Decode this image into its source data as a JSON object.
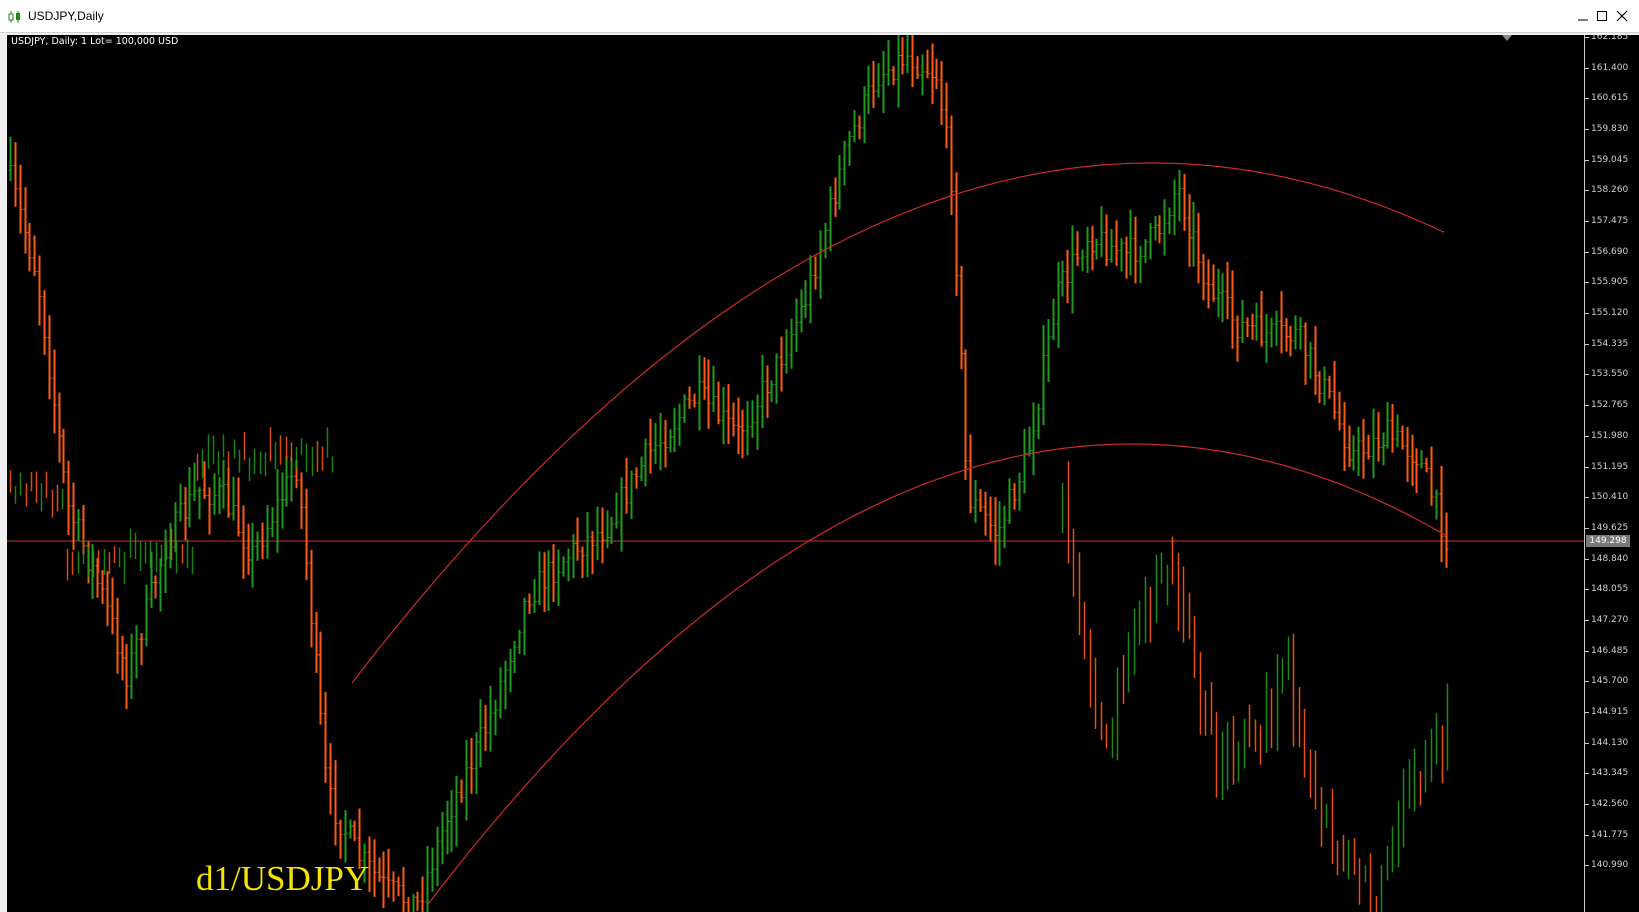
{
  "window": {
    "title": "USDJPY,Daily",
    "controls": [
      "minimize",
      "maximize",
      "close"
    ],
    "icon": "candlestick-chart-icon"
  },
  "chart": {
    "info_label": "USDJPY, Daily:  1 Lot= 100,000 USD",
    "watermark": "d1/USDJPY",
    "current_price": "149.298",
    "current_price_value": 149.298,
    "price_axis_labels": [
      "162.185",
      "161.400",
      "160.615",
      "159.830",
      "159.045",
      "158.260",
      "157.475",
      "156.690",
      "155.905",
      "155.120",
      "154.335",
      "153.550",
      "152.765",
      "151.980",
      "151.195",
      "150.410",
      "149.625",
      "148.840",
      "148.055",
      "147.270",
      "146.485",
      "145.700",
      "144.915",
      "144.130",
      "143.345",
      "142.560",
      "141.775",
      "140.990"
    ],
    "price_axis_values": [
      162.185,
      161.4,
      160.615,
      159.83,
      159.045,
      158.26,
      157.475,
      156.69,
      155.905,
      155.12,
      154.335,
      153.55,
      152.765,
      151.98,
      151.195,
      150.41,
      149.625,
      148.84,
      148.055,
      147.27,
      146.485,
      145.7,
      144.915,
      144.13,
      143.345,
      142.56,
      141.775,
      140.99
    ],
    "colors": {
      "background": "#000000",
      "bull_bar": "#1e9a1e",
      "bear_bar": "#ff5a14",
      "curve": "#cc2a2a",
      "price_line": "#c83232",
      "watermark": "#f5e400"
    }
  }
}
